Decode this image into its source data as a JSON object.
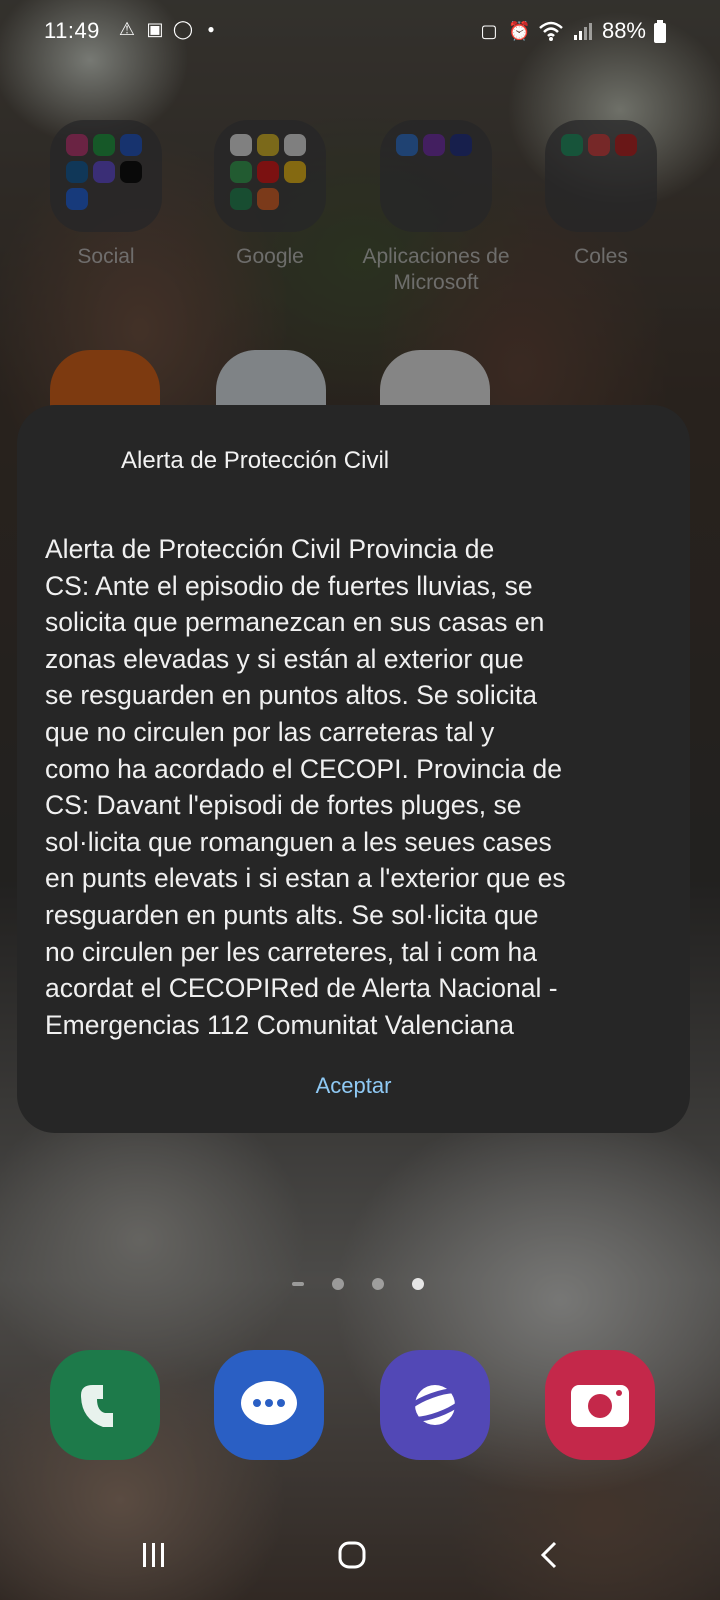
{
  "status_bar": {
    "time": "11:49",
    "battery_percent": "88%",
    "left_icons": [
      "warning-icon",
      "chat-icon",
      "whatsapp-icon",
      "dot-icon"
    ],
    "right_icons": [
      "battery-saver-icon",
      "alarm-icon",
      "wifi-icon",
      "signal-icon",
      "battery-icon"
    ]
  },
  "home_folders": [
    {
      "label": "Social",
      "apps": [
        "instagram",
        "whatsapp",
        "facebook",
        "linkedin",
        "messenger",
        "x",
        "dropbox"
      ]
    },
    {
      "label": "Google",
      "apps": [
        "google",
        "chrome",
        "gmail",
        "maps",
        "youtube",
        "drive",
        "photos"
      ]
    },
    {
      "label": "Aplicaciones de\nMicrosoft",
      "apps": [
        "onedrive",
        "onenote",
        "bing"
      ]
    },
    {
      "label": "Coles",
      "apps": [
        "classroom",
        "app",
        "app"
      ]
    }
  ],
  "dialog": {
    "title": "Alerta de Protección Civil",
    "body": "Alerta de Protección Civil Provincia de\nCS: Ante el episodio de fuertes lluvias, se\nsolicita que permanezcan en sus casas en\nzonas elevadas y si están al exterior que\nse resguarden en puntos altos. Se solicita\nque no circulen por las carreteras tal y\ncomo ha acordado el CECOPI. Provincia de\nCS:  Davant l'episodi de fortes pluges, se\nsol·licita que romanguen a les seues cases\nen punts elevats i si estan a l'exterior que es\nresguarden en punts alts. Se sol·licita que\nno circulen per les carreteres, tal i com ha\nacordat el CECOPIRed de Alerta Nacional -\nEmergencias 112 Comunitat Valenciana",
    "button_label": "Aceptar"
  },
  "dock": [
    "phone-icon",
    "messages-icon",
    "internet-icon",
    "camera-icon"
  ],
  "colors": {
    "dialog_bg": "#262626",
    "accent_button": "#8fc9f4",
    "phone": "#1d7a4a",
    "messages": "#2a5fc4",
    "internet": "#5248b6",
    "camera": "#c4284a"
  }
}
